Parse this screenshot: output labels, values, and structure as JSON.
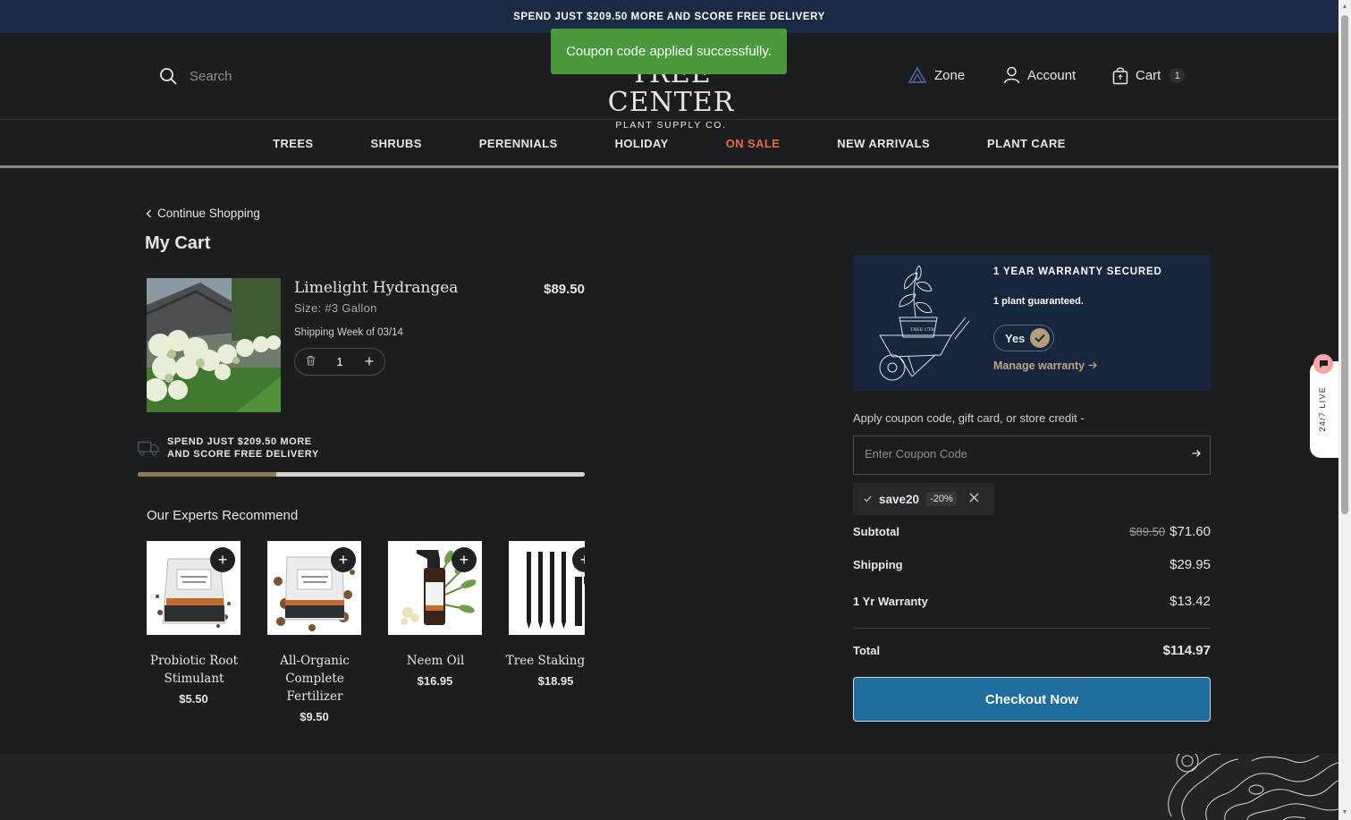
{
  "promo": {
    "text": "SPEND JUST $209.50 MORE AND SCORE FREE DELIVERY"
  },
  "toast": {
    "message": "Coupon code applied successfully."
  },
  "header": {
    "search_placeholder": "Search",
    "logo_main": "TREE CENTER",
    "logo_sub": "PLANT SUPPLY CO.",
    "zone_label": "Zone",
    "account_label": "Account",
    "cart_label": "Cart",
    "cart_count": "1"
  },
  "nav": {
    "items": [
      {
        "label": "TREES"
      },
      {
        "label": "SHRUBS"
      },
      {
        "label": "PERENNIALS"
      },
      {
        "label": "HOLIDAY"
      },
      {
        "label": "ON SALE"
      },
      {
        "label": "NEW ARRIVALS"
      },
      {
        "label": "PLANT CARE"
      }
    ]
  },
  "cart": {
    "continue_label": "Continue Shopping",
    "title": "My Cart",
    "item": {
      "name": "Limelight Hydrangea",
      "size": "Size: #3 Gallon",
      "price": "$89.50",
      "shipping_week": "Shipping Week of 03/14",
      "quantity": "1"
    },
    "delivery_line1": "SPEND JUST $209.50 MORE",
    "delivery_line2": "AND SCORE FREE DELIVERY",
    "delivery_progress_percent": 31
  },
  "recommend": {
    "title": "Our Experts Recommend",
    "items": [
      {
        "name": "Probiotic Root Stimulant",
        "price": "$5.50"
      },
      {
        "name": "All-Organic Complete Fertilizer",
        "price": "$9.50"
      },
      {
        "name": "Neem Oil",
        "price": "$16.95"
      },
      {
        "name": "Tree Staking Kit",
        "price": "$18.95"
      }
    ]
  },
  "warranty": {
    "title": "1 YEAR WARRANTY SECURED",
    "desc": "1 plant guaranteed.",
    "toggle_label": "Yes",
    "manage_label": "Manage warranty"
  },
  "coupon": {
    "label": "Apply coupon code, gift card, or store credit -",
    "placeholder": "Enter Coupon Code",
    "applied_code": "save20",
    "applied_discount": "-20%"
  },
  "summary": {
    "subtotal_label": "Subtotal",
    "subtotal_old": "$89.50",
    "subtotal_new": "$71.60",
    "shipping_label": "Shipping",
    "shipping_value": "$29.95",
    "warranty_label": "1 Yr Warranty",
    "warranty_value": "$13.42",
    "total_label": "Total",
    "total_value": "$114.97",
    "checkout_label": "Checkout Now"
  },
  "live_chat": {
    "label": "24/7 LIVE"
  },
  "colors": {
    "background": "#1b1d1f",
    "promo_bar": "#1a2a44",
    "sale": "#e46a4b",
    "toast": "#4a9a3d",
    "checkout": "#1e6d9c",
    "warranty_panel": "#17263d",
    "accent_gold": "#b19f7c"
  }
}
